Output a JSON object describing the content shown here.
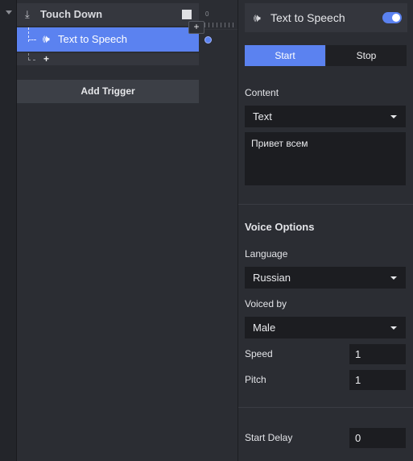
{
  "tree": {
    "trigger_label": "Touch Down",
    "action_label": "Text to Speech",
    "plus_badge": "+",
    "add_action_plus": "+",
    "add_trigger_label": "Add Trigger"
  },
  "timeline": {
    "tick_start": "0"
  },
  "panel": {
    "title": "Text to Speech",
    "enabled": true,
    "tabs": {
      "start": "Start",
      "stop": "Stop"
    },
    "content_label": "Content",
    "content_type": "Text",
    "content_text": "Привет всем",
    "voice_options_heading": "Voice Options",
    "language_label": "Language",
    "language_value": "Russian",
    "voiced_by_label": "Voiced by",
    "voiced_by_value": "Male",
    "speed_label": "Speed",
    "speed_value": "1",
    "pitch_label": "Pitch",
    "pitch_value": "1",
    "start_delay_label": "Start Delay",
    "start_delay_value": "0"
  },
  "colors": {
    "accent": "#5b82f0",
    "panel_bg": "#2b2d33",
    "input_bg": "#1c1d21"
  },
  "icons": {
    "trigger": "down-arrow-icon",
    "action": "speech-wave-icon",
    "stop": "stop-square-icon"
  }
}
